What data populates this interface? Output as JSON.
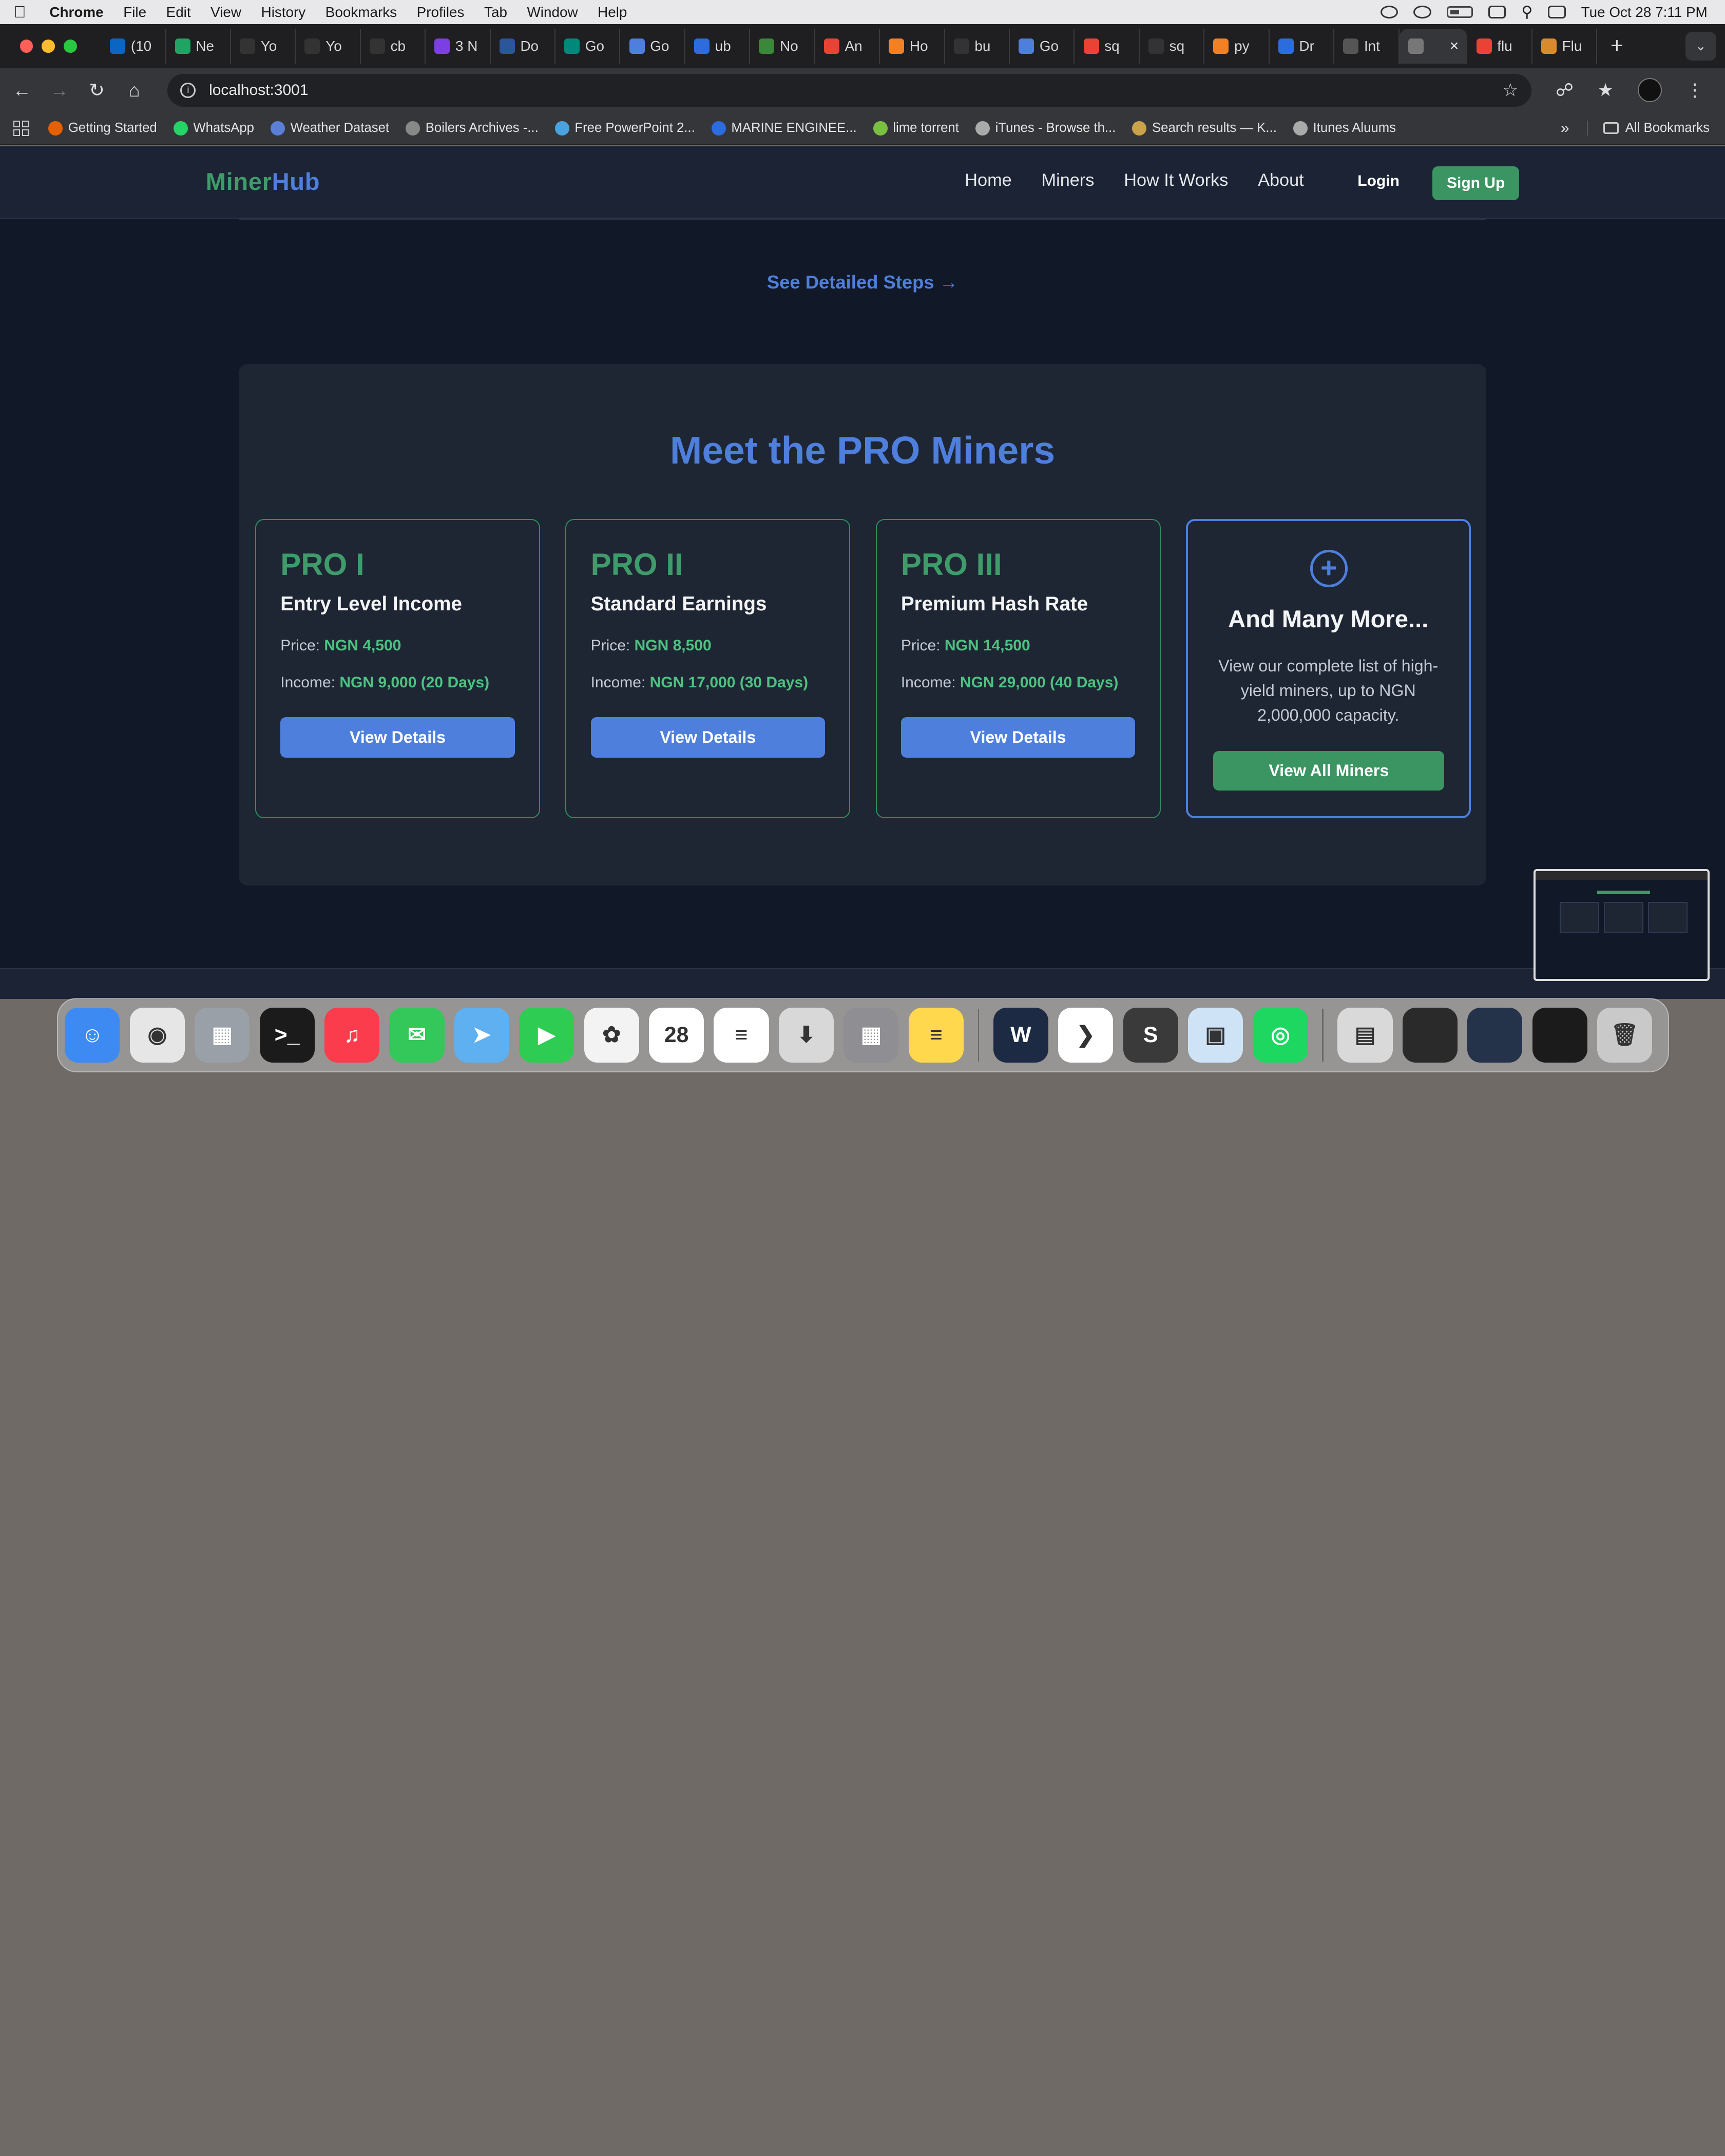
{
  "menubar": {
    "app": "Chrome",
    "items": [
      "File",
      "Edit",
      "View",
      "History",
      "Bookmarks",
      "Profiles",
      "Tab",
      "Window",
      "Help"
    ],
    "clock": "Tue Oct 28  7:11 PM"
  },
  "tabs": [
    {
      "label": "(10",
      "icon": "linkedin-icon",
      "color": "#0a66c2"
    },
    {
      "label": "Ne",
      "icon": "drive-icon",
      "color": "#1fa463"
    },
    {
      "label": "Yo",
      "icon": "github-icon",
      "color": "#333333"
    },
    {
      "label": "Yo",
      "icon": "github-icon",
      "color": "#333333"
    },
    {
      "label": "cb",
      "icon": "github-icon",
      "color": "#333333"
    },
    {
      "label": "3 N",
      "icon": "mail-icon",
      "color": "#7b3fe4"
    },
    {
      "label": "Do",
      "icon": "word-icon",
      "color": "#2b579a"
    },
    {
      "label": "Go",
      "icon": "meet-icon",
      "color": "#00897b"
    },
    {
      "label": "Go",
      "icon": "gemini-icon",
      "color": "#4f7fdc"
    },
    {
      "label": "ub",
      "icon": "loader-icon",
      "color": "#2d6cdf"
    },
    {
      "label": "No",
      "icon": "node-icon",
      "color": "#3c873a"
    },
    {
      "label": "An",
      "icon": "google-icon",
      "color": "#ea4335"
    },
    {
      "label": "Ho",
      "icon": "stackoverflow-icon",
      "color": "#f48024"
    },
    {
      "label": "bu",
      "icon": "github-icon",
      "color": "#333333"
    },
    {
      "label": "Go",
      "icon": "gemini-icon",
      "color": "#4f7fdc"
    },
    {
      "label": "sq",
      "icon": "google-icon",
      "color": "#ea4335"
    },
    {
      "label": "sq",
      "icon": "github-icon",
      "color": "#333333"
    },
    {
      "label": "py",
      "icon": "stackoverflow-icon",
      "color": "#f48024"
    },
    {
      "label": "Dr",
      "icon": "loader-icon",
      "color": "#2d6cdf"
    },
    {
      "label": "Int",
      "icon": "openai-icon",
      "color": "#555555"
    },
    {
      "label": "",
      "icon": "globe-icon",
      "color": "#777777",
      "active": true
    },
    {
      "label": "flu",
      "icon": "google-icon",
      "color": "#ea4335"
    },
    {
      "label": "Flu",
      "icon": "flutter-icon",
      "color": "#d98a2b"
    }
  ],
  "toolbar": {
    "url": "localhost:3001"
  },
  "bookmarks": [
    {
      "label": "Getting Started",
      "color": "#e66000"
    },
    {
      "label": "WhatsApp",
      "color": "#25d366"
    },
    {
      "label": "Weather Dataset",
      "color": "#5b7fd6"
    },
    {
      "label": "Boilers Archives -...",
      "color": "#888888"
    },
    {
      "label": "Free PowerPoint 2...",
      "color": "#4aa3df"
    },
    {
      "label": "MARINE ENGINEE...",
      "color": "#2d6cdf"
    },
    {
      "label": "lime torrent",
      "color": "#7ac142"
    },
    {
      "label": "iTunes - Browse th...",
      "color": "#aaaaaa"
    },
    {
      "label": "Search results — K...",
      "color": "#c9a24a"
    },
    {
      "label": "Itunes Aluums",
      "color": "#aaaaaa"
    }
  ],
  "bookmarks_all": "All Bookmarks",
  "site": {
    "logo_a": "Miner",
    "logo_b": "Hub",
    "nav": [
      "Home",
      "Miners",
      "How It Works",
      "About"
    ],
    "login": "Login",
    "signup": "Sign Up",
    "steps_link": "See Detailed Steps →",
    "section_title": "Meet the PRO Miners",
    "price_label": "Price:",
    "income_label": "Income:",
    "cards": [
      {
        "tier": "PRO I",
        "subtitle": "Entry Level Income",
        "price": "NGN 4,500",
        "income": "NGN 9,000 (20 Days)",
        "button": "View Details"
      },
      {
        "tier": "PRO II",
        "subtitle": "Standard Earnings",
        "price": "NGN 8,500",
        "income": "NGN 17,000 (30 Days)",
        "button": "View Details"
      },
      {
        "tier": "PRO III",
        "subtitle": "Premium Hash Rate",
        "price": "NGN 14,500",
        "income": "NGN 29,000 (40 Days)",
        "button": "View Details"
      }
    ],
    "more": {
      "plus": "+",
      "title": "And Many More...",
      "description": "View our complete list of high-yield miners, up to NGN 2,000,000 capacity.",
      "button": "View All Miners"
    }
  },
  "dock": [
    {
      "name": "finder-icon",
      "color": "#3d8bf2",
      "glyph": "☺"
    },
    {
      "name": "chrome-icon",
      "color": "#e6e6e6",
      "glyph": "◉"
    },
    {
      "name": "launchpad-icon",
      "color": "#9aa0a8",
      "glyph": "▦"
    },
    {
      "name": "terminal-icon",
      "color": "#1b1b1b",
      "glyph": ">_"
    },
    {
      "name": "music-icon",
      "color": "#fa3c4c",
      "glyph": "♫"
    },
    {
      "name": "messages-icon",
      "color": "#34c759",
      "glyph": "✉"
    },
    {
      "name": "maps-icon",
      "color": "#5fb0f0",
      "glyph": "➤"
    },
    {
      "name": "facetime-icon",
      "color": "#2ecc52",
      "glyph": "▶"
    },
    {
      "name": "photos-icon",
      "color": "#f3f3f3",
      "glyph": "✿"
    },
    {
      "name": "calendar-icon",
      "color": "#ffffff",
      "glyph": "28"
    },
    {
      "name": "reminders-icon",
      "color": "#ffffff",
      "glyph": "≡"
    },
    {
      "name": "downloader-icon",
      "color": "#d8d8d8",
      "glyph": "⬇"
    },
    {
      "name": "calculator-icon",
      "color": "#8e8e93",
      "glyph": "▦"
    },
    {
      "name": "notes-icon",
      "color": "#ffd84d",
      "glyph": "≡"
    },
    {
      "name": "sep"
    },
    {
      "name": "webstorm-icon",
      "color": "#1d2a44",
      "glyph": "W"
    },
    {
      "name": "vscode-icon",
      "color": "#ffffff",
      "glyph": "❯"
    },
    {
      "name": "sublime-icon",
      "color": "#3a3a3a",
      "glyph": "S"
    },
    {
      "name": "preview-icon",
      "color": "#cfe3f7",
      "glyph": "▣"
    },
    {
      "name": "spotify-icon",
      "color": "#1ed760",
      "glyph": "◎"
    },
    {
      "name": "sep"
    },
    {
      "name": "archive-icon",
      "color": "#d9d9d9",
      "glyph": "▤"
    },
    {
      "name": "terminal-window-thumb",
      "color": "#2a2a2a",
      "glyph": ""
    },
    {
      "name": "app-window-thumb",
      "color": "#24324a",
      "glyph": ""
    },
    {
      "name": "app-window-thumb-2",
      "color": "#1b1b1b",
      "glyph": ""
    },
    {
      "name": "trash-icon",
      "color": "#c9c9c9",
      "glyph": "🗑"
    }
  ]
}
